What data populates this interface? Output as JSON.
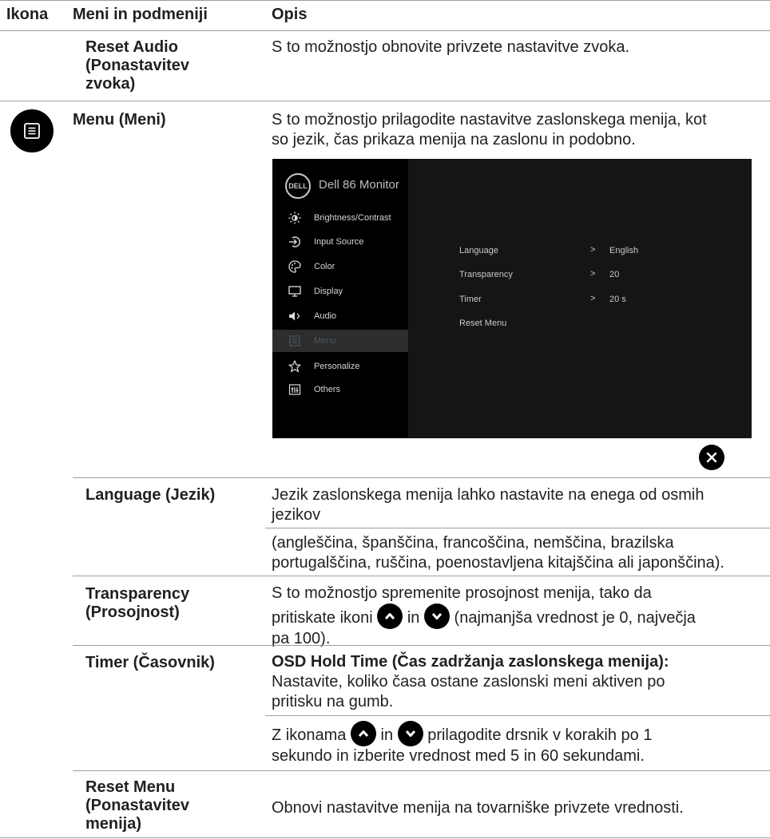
{
  "header": {
    "col_icon": "Ikona",
    "col_menu": "Meni in podmeniji",
    "col_desc": "Opis"
  },
  "rows": {
    "reset_audio": {
      "name_lines": [
        "Reset Audio",
        "(Ponastavitev",
        "zvoka)"
      ],
      "desc": "S to možnostjo obnovite privzete nastavitve zvoka."
    },
    "menu": {
      "icon": "menu-list-icon",
      "name": "Menu (Meni)",
      "desc_lines": [
        "S to možnostjo prilagodite nastavitve zaslonskega menija, kot",
        "so jezik, čas prikaza menija na zaslonu in podobno."
      ]
    },
    "language": {
      "name": "Language (Jezik)",
      "desc_lines": [
        "Jezik zaslonskega menija lahko nastavite na enega od osmih",
        "jezikov"
      ],
      "desc2_lines": [
        "(angleščina, španščina, francoščina, nemščina, brazilska",
        "portugalščina, ruščina, poenostavljena kitajščina ali japonščina)."
      ]
    },
    "transparency": {
      "name_lines": [
        "Transparency",
        "(Prosojnost)"
      ],
      "desc_line1": "S to možnostjo spremenite prosojnost menija, tako da",
      "desc_pre": "pritiskate ikoni",
      "desc_mid": "in",
      "desc_post": "(najmanjša vrednost je 0, največja",
      "desc_line3": "pa 100)."
    },
    "timer": {
      "name": "Timer (Časovnik)",
      "desc_bold": "OSD Hold Time (Čas zadržanja zaslonskega menija):",
      "desc_lines": [
        "Nastavite, koliko časa ostane zaslonski meni aktiven po",
        "pritisku na gumb."
      ],
      "desc2_pre": "Z ikonama",
      "desc2_mid": "in",
      "desc2_post": "prilagodite drsnik v korakih po 1",
      "desc2_line2": "sekundo in izberite vrednost med 5 in 60 sekundami."
    },
    "reset_menu": {
      "name_lines": [
        "Reset Menu",
        "(Ponastavitev",
        "menija)"
      ],
      "desc": "Obnovi nastavitve menija na tovarniške privzete vrednosti."
    }
  },
  "osd": {
    "logo_text": "DELL",
    "title": "Dell 86 Monitor",
    "menu_items": [
      {
        "label": "Brightness/Contrast",
        "icon": "brightness-icon"
      },
      {
        "label": "Input Source",
        "icon": "input-source-icon"
      },
      {
        "label": "Color",
        "icon": "color-palette-icon"
      },
      {
        "label": "Display",
        "icon": "display-icon"
      },
      {
        "label": "Audio",
        "icon": "speaker-icon"
      },
      {
        "label": "Menu",
        "icon": "menu-list-icon",
        "selected": true
      },
      {
        "label": "Personalize",
        "icon": "star-icon"
      },
      {
        "label": "Others",
        "icon": "others-icon"
      }
    ],
    "settings": [
      {
        "label": "Language",
        "value": "English"
      },
      {
        "label": "Transparency",
        "value": "20"
      },
      {
        "label": "Timer",
        "value": "20 s"
      },
      {
        "label": "Reset Menu",
        "value": ""
      }
    ],
    "arrow_glyph": ">",
    "close_icon": "close-icon"
  }
}
